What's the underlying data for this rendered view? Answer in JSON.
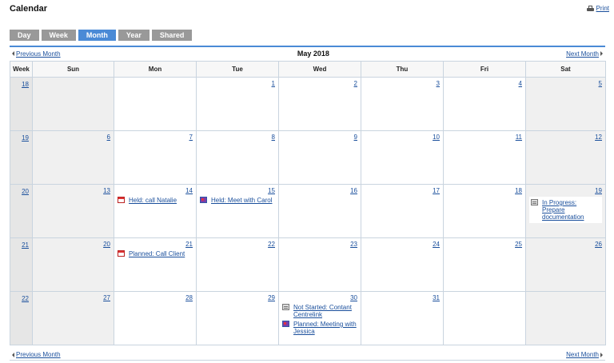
{
  "header": {
    "title": "Calendar",
    "print_label": "Print"
  },
  "view_tabs": [
    {
      "label": "Day",
      "active": false
    },
    {
      "label": "Week",
      "active": false
    },
    {
      "label": "Month",
      "active": true
    },
    {
      "label": "Year",
      "active": false
    },
    {
      "label": "Shared",
      "active": false
    }
  ],
  "nav": {
    "prev_label": "Previous Month",
    "next_label": "Next Month",
    "month_label": "May 2018"
  },
  "columns": [
    "Week",
    "Sun",
    "Mon",
    "Tue",
    "Wed",
    "Thu",
    "Fri",
    "Sat"
  ],
  "weeks": [
    {
      "week": "18",
      "days": [
        "",
        "",
        "1",
        "2",
        "3",
        "4",
        "5"
      ]
    },
    {
      "week": "19",
      "days": [
        "6",
        "7",
        "8",
        "9",
        "10",
        "11",
        "12"
      ]
    },
    {
      "week": "20",
      "days": [
        "13",
        "14",
        "15",
        "16",
        "17",
        "18",
        "19"
      ]
    },
    {
      "week": "21",
      "days": [
        "20",
        "21",
        "22",
        "23",
        "24",
        "25",
        "26"
      ]
    },
    {
      "week": "22",
      "days": [
        "27",
        "28",
        "29",
        "30",
        "31",
        "",
        ""
      ]
    }
  ],
  "events": {
    "w20_mon": {
      "label": "Held: call Natalie",
      "icon": "call-icon"
    },
    "w20_tue": {
      "label": "Held: Meet with Carol",
      "icon": "meeting-icon"
    },
    "w20_sat": {
      "label": "In Progress: Prepare documentation",
      "icon": "task-icon"
    },
    "w21_mon": {
      "label": "Planned: Call Client",
      "icon": "call-icon"
    },
    "w22_wed_1": {
      "label": "Not Started: Contant Centrelink",
      "icon": "task-icon"
    },
    "w22_wed_2": {
      "label": "Planned: Meeting with Jessica",
      "icon": "meeting-icon"
    }
  },
  "colors": {
    "accent": "#4a8ad6",
    "link": "#1a4f9c",
    "tab_inactive": "#999999"
  }
}
